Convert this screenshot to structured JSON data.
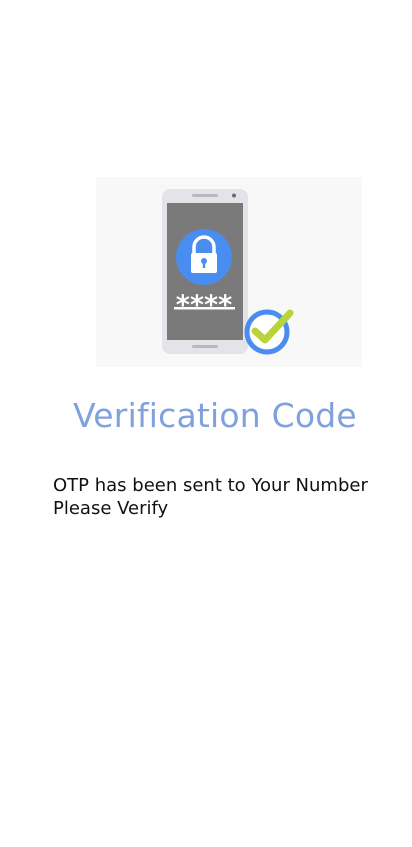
{
  "illustration": {
    "phone_icon": "smartphone-icon",
    "lock_icon": "padlock-icon",
    "check_icon": "checkmark-circle-icon",
    "masked_code": "****",
    "colors": {
      "screen": "#7a7a7a",
      "phone_body": "#e3e4ea",
      "lock_circle": "#4a8df0",
      "check_ring": "#4a8df0",
      "check_mark": "#b9d43a"
    }
  },
  "title": "Verification Code",
  "message": {
    "line1": "OTP has been sent to Your Number",
    "line2": "Please Verify"
  },
  "colors": {
    "title": "#7fa1dc",
    "body_text": "#111111",
    "background": "#ffffff"
  }
}
